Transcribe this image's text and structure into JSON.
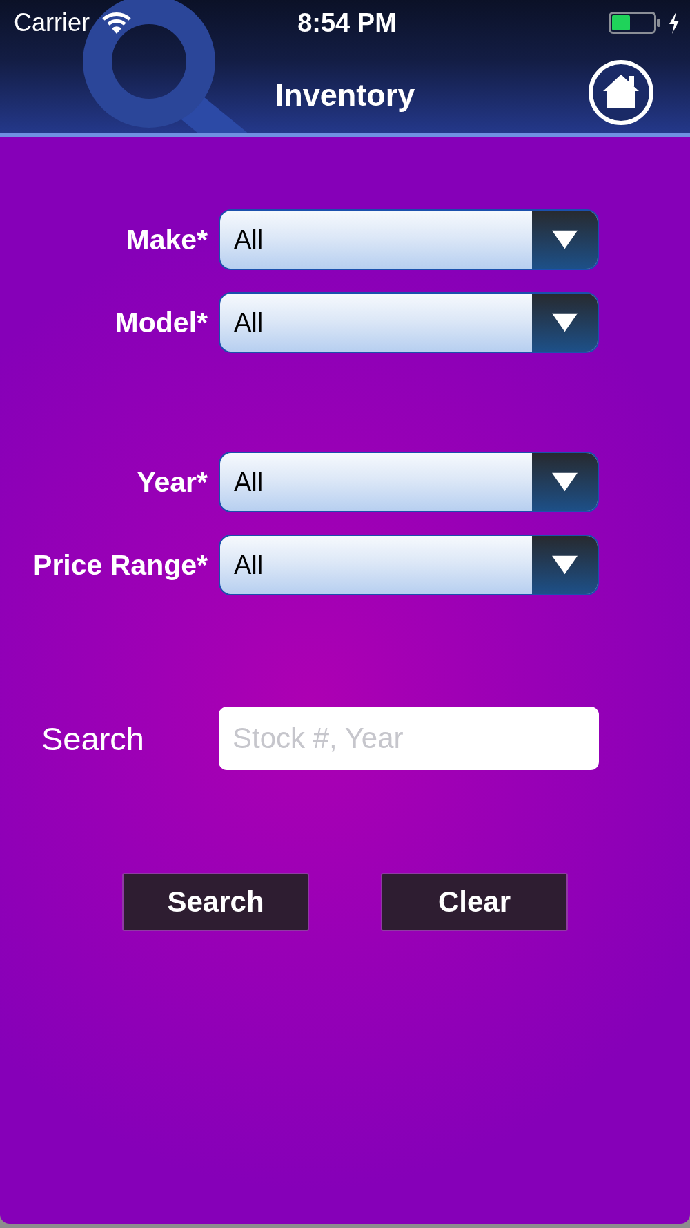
{
  "status_bar": {
    "carrier": "Carrier",
    "time": "8:54 PM"
  },
  "nav_bar": {
    "title": "Inventory"
  },
  "filter_groups": [
    [
      {
        "label": "Make*",
        "value": "All"
      },
      {
        "label": "Model*",
        "value": "All"
      }
    ],
    [
      {
        "label": "Year*",
        "value": "All"
      },
      {
        "label": "Price Range*",
        "value": "All"
      }
    ]
  ],
  "search": {
    "label": "Search",
    "placeholder": "Stock #, Year"
  },
  "buttons": [
    {
      "label": "Search"
    },
    {
      "label": "Clear"
    }
  ]
}
